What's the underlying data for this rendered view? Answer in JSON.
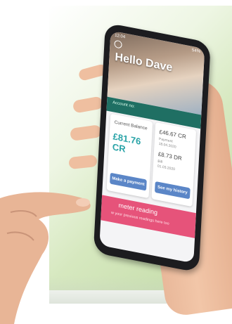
{
  "status": {
    "time": "12:04",
    "battery": "54%"
  },
  "greeting": "Hello Dave",
  "account_label": "Account no:",
  "balance": {
    "label": "Current Balance",
    "value": "£81.76 CR"
  },
  "transactions": [
    {
      "amount": "£46.67 CR",
      "type": "Payment",
      "date": "18.04.2020"
    },
    {
      "amount": "£8.73 DR",
      "type": "Bill",
      "date": "01.03.2020"
    }
  ],
  "buttons": {
    "payment": "Make a payment",
    "history": "See my history"
  },
  "meter": {
    "title": "meter reading",
    "subtitle": "w your previous readings here too"
  }
}
